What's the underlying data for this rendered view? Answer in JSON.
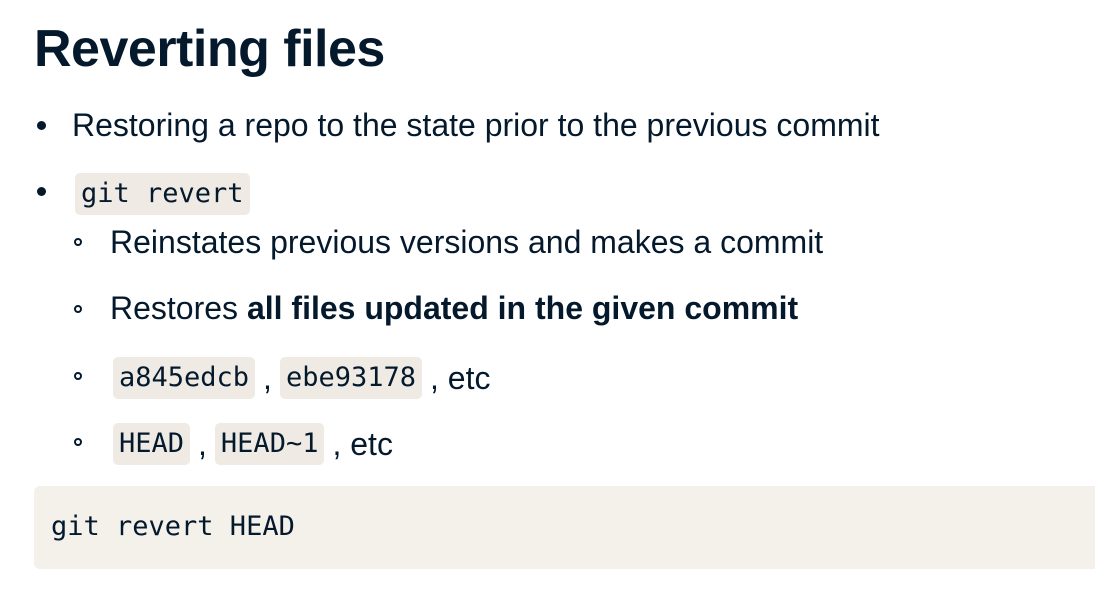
{
  "title": "Reverting files",
  "bullets": [
    {
      "text": "Restoring a repo to the state prior to the previous commit"
    },
    {
      "code": "git revert"
    }
  ],
  "sub_bullets": {
    "item1": "Reinstates previous versions and makes a commit",
    "item2_prefix": "Restores ",
    "item2_bold": "all files updated in the given commit",
    "item3_code1": "a845edcb",
    "item3_sep": ",",
    "item3_code2": "ebe93178",
    "item3_suffix": ", etc",
    "item4_code1": "HEAD",
    "item4_sep": ",",
    "item4_code2": "HEAD~1",
    "item4_suffix": ", etc"
  },
  "code_block": "git revert HEAD",
  "colors": {
    "text": "#05192d",
    "inline_code_bg": "#efebe4",
    "code_block_bg": "#f4f0ea"
  }
}
